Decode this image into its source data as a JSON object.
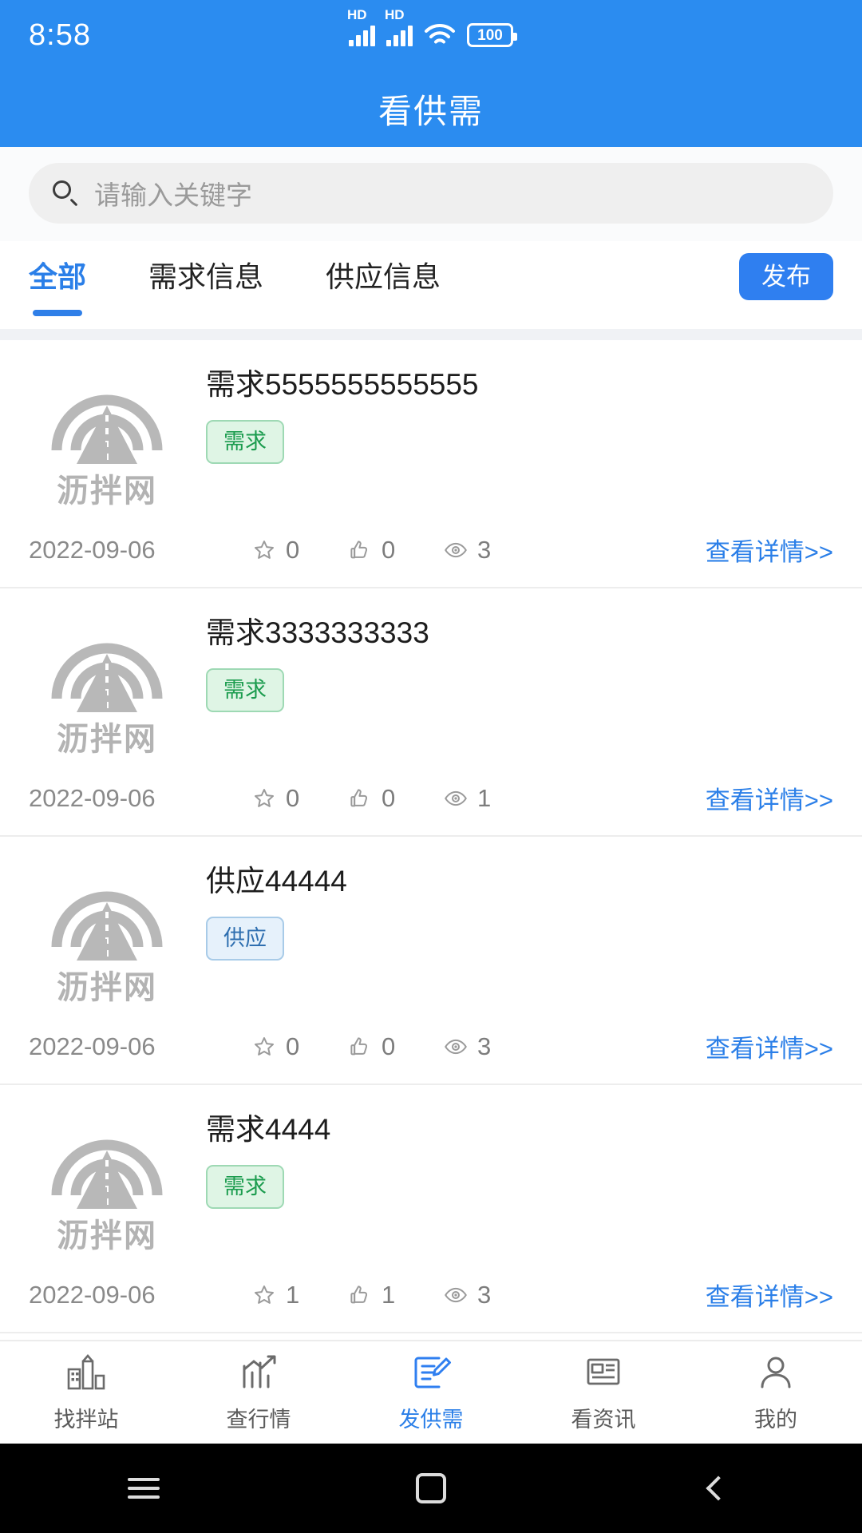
{
  "status_bar": {
    "time": "8:58",
    "signal1_label": "HD",
    "signal2_label": "HD",
    "battery_level": "100"
  },
  "header": {
    "title": "看供需"
  },
  "search": {
    "placeholder": "请输入关键字",
    "value": ""
  },
  "tabs": {
    "items": [
      {
        "label": "全部",
        "active": true
      },
      {
        "label": "需求信息",
        "active": false
      },
      {
        "label": "供应信息",
        "active": false
      }
    ],
    "publish_label": "发布"
  },
  "logo": {
    "text": "沥拌网"
  },
  "list": {
    "detail_link_label": "查看详情>>",
    "items": [
      {
        "title": "需求5555555555555",
        "badge": "需求",
        "badge_type": "demand",
        "date": "2022-09-06",
        "favorites": "0",
        "likes": "0",
        "views": "3"
      },
      {
        "title": "需求3333333333",
        "badge": "需求",
        "badge_type": "demand",
        "date": "2022-09-06",
        "favorites": "0",
        "likes": "0",
        "views": "1"
      },
      {
        "title": "供应44444",
        "badge": "供应",
        "badge_type": "supply",
        "date": "2022-09-06",
        "favorites": "0",
        "likes": "0",
        "views": "3"
      },
      {
        "title": "需求4444",
        "badge": "需求",
        "badge_type": "demand",
        "date": "2022-09-06",
        "favorites": "1",
        "likes": "1",
        "views": "3"
      }
    ]
  },
  "bottom_nav": {
    "items": [
      {
        "label": "找拌站",
        "icon": "plant-icon",
        "active": false
      },
      {
        "label": "查行情",
        "icon": "chart-trend-icon",
        "active": false
      },
      {
        "label": "发供需",
        "icon": "edit-document-icon",
        "active": true
      },
      {
        "label": "看资讯",
        "icon": "news-icon",
        "active": false
      },
      {
        "label": "我的",
        "icon": "user-icon",
        "active": false
      }
    ]
  },
  "colors": {
    "brand_blue": "#2b8cf0",
    "accent_blue": "#2f7ff0",
    "demand_green": "#1b9c4e",
    "supply_blue": "#2f6fb0"
  }
}
